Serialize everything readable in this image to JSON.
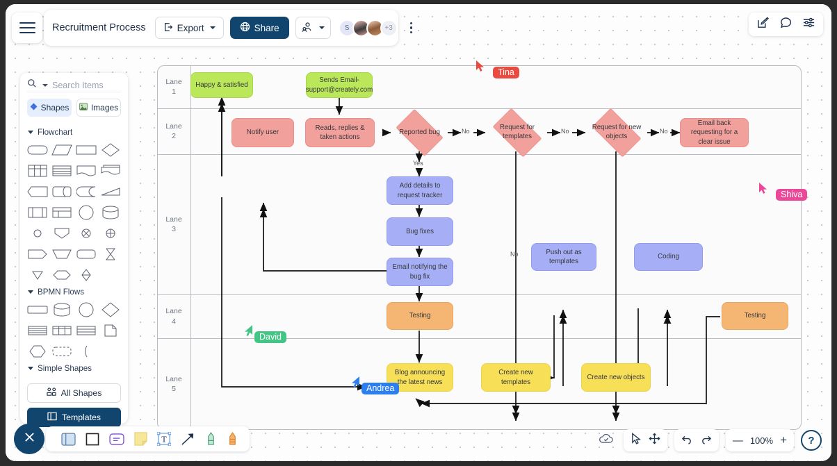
{
  "header": {
    "menu_icon": "hamburger-icon",
    "doc_title": "Recruitment Process",
    "export_label": "Export",
    "share_label": "Share",
    "collab_icon": "collaborator-icon",
    "avatar_initial": "S",
    "avatar_overflow": "+3",
    "more_icon": "kebab-menu-icon",
    "right_icons": [
      "edit-icon",
      "comment-icon",
      "settings-sliders-icon"
    ]
  },
  "sidebar": {
    "search_placeholder": "Search Items",
    "search_icon": "search-icon",
    "tabs": [
      {
        "label": "Shapes",
        "icon": "diamond-icon",
        "active": true
      },
      {
        "label": "Images",
        "icon": "image-icon",
        "active": false
      }
    ],
    "categories": [
      {
        "label": "Flowchart",
        "expanded": true,
        "shape_count": 27
      },
      {
        "label": "BPMN Flows",
        "expanded": true,
        "shape_count": 11
      },
      {
        "label": "Simple Shapes",
        "expanded": true,
        "shape_count": 0
      }
    ],
    "all_shapes_label": "All Shapes",
    "templates_label": "Templates"
  },
  "bottom_toolbar": {
    "close_icon": "close-icon",
    "tools": [
      "frame-icon",
      "rectangle-icon",
      "card-icon",
      "sticky-note-icon",
      "text-icon",
      "arrow-icon",
      "highlighter-icon",
      "marker-icon"
    ]
  },
  "bottom_right": {
    "cloud_icon": "cloud-save-icon",
    "select_icon": "pointer-icon",
    "pan_icon": "move-icon",
    "undo_icon": "undo-icon",
    "redo_icon": "redo-icon",
    "zoom_out_label": "—",
    "zoom_level": "100%",
    "zoom_in_label": "+",
    "help_label": "?"
  },
  "diagram": {
    "lanes": [
      {
        "label": "Lane\n1"
      },
      {
        "label": "Lane\n2"
      },
      {
        "label": "Lane\n3"
      },
      {
        "label": "Lane\n4"
      },
      {
        "label": "Lane\n5"
      }
    ],
    "nodes": [
      {
        "id": "n1",
        "text": "Happy & satisfied",
        "color": "green",
        "shape": "rect",
        "lane": 1
      },
      {
        "id": "n2",
        "text": "Sends Email-support@creately.com",
        "color": "green",
        "shape": "rect",
        "lane": 1
      },
      {
        "id": "n3",
        "text": "Notify user",
        "color": "red",
        "shape": "rect",
        "lane": 2
      },
      {
        "id": "n4",
        "text": "Reads, replies & taken actions",
        "color": "red",
        "shape": "rect",
        "lane": 2
      },
      {
        "id": "n5",
        "text": "Reported bug",
        "color": "red",
        "shape": "diamond",
        "lane": 2
      },
      {
        "id": "n6",
        "text": "Request for templates",
        "color": "red",
        "shape": "diamond",
        "lane": 2
      },
      {
        "id": "n7",
        "text": "Request for new objects",
        "color": "red",
        "shape": "diamond",
        "lane": 2
      },
      {
        "id": "n8",
        "text": "Email back requesting for a clear issue",
        "color": "red",
        "shape": "rect",
        "lane": 2
      },
      {
        "id": "n9",
        "text": "Add details to request tracker",
        "color": "blue",
        "shape": "rect",
        "lane": 3
      },
      {
        "id": "n10",
        "text": "Bug fixes",
        "color": "blue",
        "shape": "rect",
        "lane": 3
      },
      {
        "id": "n11",
        "text": "Email notifying the bug fix",
        "color": "blue",
        "shape": "rect",
        "lane": 3
      },
      {
        "id": "n12",
        "text": "Push out as templates",
        "color": "blue",
        "shape": "rect",
        "lane": 3
      },
      {
        "id": "n13",
        "text": "Coding",
        "color": "blue",
        "shape": "rect",
        "lane": 3
      },
      {
        "id": "n14",
        "text": "Testing",
        "color": "orange",
        "shape": "rect",
        "lane": 4
      },
      {
        "id": "n15",
        "text": "Testing",
        "color": "orange",
        "shape": "rect",
        "lane": 4
      },
      {
        "id": "n16",
        "text": "Blog announcing the latest news",
        "color": "yellow",
        "shape": "rect",
        "lane": 5
      },
      {
        "id": "n17",
        "text": "Create new templates",
        "color": "yellow",
        "shape": "rect",
        "lane": 5
      },
      {
        "id": "n18",
        "text": "Create new objects",
        "color": "yellow",
        "shape": "rect",
        "lane": 5
      }
    ],
    "edge_labels": [
      {
        "id": "e1",
        "text": "No"
      },
      {
        "id": "e2",
        "text": "No"
      },
      {
        "id": "e3",
        "text": "No"
      },
      {
        "id": "e4",
        "text": "Yes"
      },
      {
        "id": "e5",
        "text": "No"
      }
    ],
    "colors": {
      "green": "#bbe85a",
      "red": "#f2a09c",
      "blue": "#a6aef5",
      "orange": "#f5b674",
      "yellow": "#f7df58",
      "lane_border": "#b9bcc4"
    }
  },
  "cursors": [
    {
      "name": "Tina",
      "color": "#ea4b41"
    },
    {
      "name": "Shiva",
      "color": "#ec4899"
    },
    {
      "name": "David",
      "color": "#45c585"
    },
    {
      "name": "Andrea",
      "color": "#2d7ff0"
    }
  ]
}
